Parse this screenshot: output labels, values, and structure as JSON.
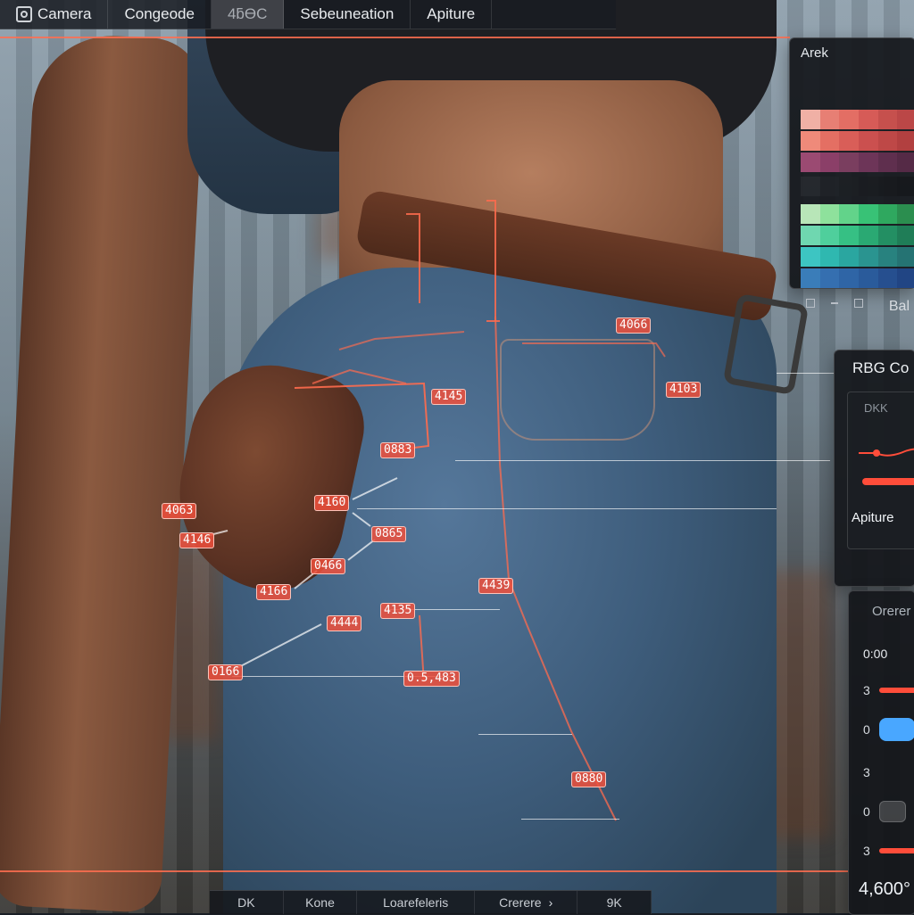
{
  "top_toolbar": {
    "tabs": [
      {
        "label": "Camera",
        "icon": "camera-icon"
      },
      {
        "label": "Congeode"
      },
      {
        "label": "4ƃƟC",
        "active": true
      },
      {
        "label": "Sebeuneation"
      },
      {
        "label": "Apiture"
      }
    ]
  },
  "palette_panel": {
    "title": "Arek",
    "bottom_label": "Bal"
  },
  "rbg_panel": {
    "title": "RBG Co",
    "subtitle": "DKK",
    "aperture_label": "Apiture"
  },
  "settings_panel": {
    "title": "Orerer",
    "value_top": "0:00",
    "rows": [
      "3",
      "0",
      "3",
      "0",
      "3"
    ],
    "bottom_value": "4,600°"
  },
  "bottom_bar": {
    "items": [
      "DK",
      "Kone",
      "Loarefeleris",
      "Crerere",
      "9K"
    ],
    "chevron": "›"
  },
  "annotations": [
    {
      "id": "t1",
      "text": "4066"
    },
    {
      "id": "t2",
      "text": "4103"
    },
    {
      "id": "t3",
      "text": "4145"
    },
    {
      "id": "t4",
      "text": "0883"
    },
    {
      "id": "t5",
      "text": "4063"
    },
    {
      "id": "t6",
      "text": "4160"
    },
    {
      "id": "t7",
      "text": "4146"
    },
    {
      "id": "t8",
      "text": "0865"
    },
    {
      "id": "t9",
      "text": "0466"
    },
    {
      "id": "t10",
      "text": "4166"
    },
    {
      "id": "t11",
      "text": "4439"
    },
    {
      "id": "t12",
      "text": "4135"
    },
    {
      "id": "t13",
      "text": "4444"
    },
    {
      "id": "t14",
      "text": "0166"
    },
    {
      "id": "t15",
      "text": "0.5,483"
    },
    {
      "id": "t16",
      "text": "0880"
    }
  ],
  "colors": {
    "accent": "#ff5a3c",
    "panel_bg": "#14161a",
    "swatch_warm_1": "#e07a6a",
    "swatch_warm_2": "#d06a5f",
    "swatch_purple": "#7a3e5f",
    "swatch_green_1": "#7ad38a",
    "swatch_green_2": "#2f9f5a",
    "swatch_teal": "#2fb8b0",
    "swatch_blue": "#2a6ea8",
    "slider_red": "#ff4d3a",
    "slider_blue": "#49a7ff"
  }
}
